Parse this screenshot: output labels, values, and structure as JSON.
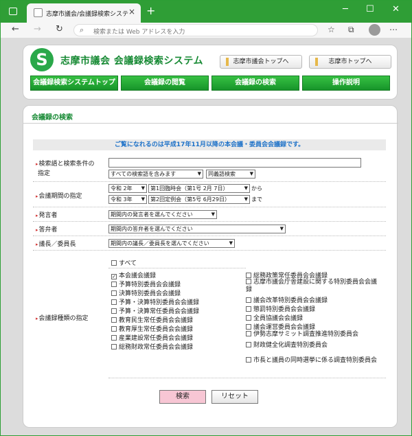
{
  "browser": {
    "tab_title": "志摩市議会/会議録検索システム",
    "close_tab": "×",
    "new_tab": "+",
    "address_placeholder": "検索または Web アドレスを入力",
    "back": "←",
    "forward": "→",
    "reload": "↻",
    "minimize": "─",
    "maximize": "☐",
    "close": "✕",
    "more": "⋯"
  },
  "header": {
    "site_title": "志摩市議会  会議録検索システム",
    "link_council_top": "志摩市議会トップへ",
    "link_city_top": "志摩市トップへ",
    "nav": [
      "会議録検索システムトップ",
      "会議録の閲覧",
      "会議録の検索",
      "操作説明"
    ]
  },
  "search": {
    "section_title": "会議録の検索",
    "notice": "ご覧になれるのは平成17年11月以降の本会議・委員会会議録です。",
    "keyword_label_1": "検索語と検索条件の",
    "keyword_label_2": "指定",
    "keyword_value": "",
    "keyword_condition": "すべての検索語を含みます",
    "keyword_type": "同義語検索",
    "period_label": "会議期間の指定",
    "period_from_era": "令和 2年",
    "period_from_session": "第1回臨時会（第1号 2月 7日）",
    "period_from_suffix": "から",
    "period_to_era": "令和 3年",
    "period_to_session": "第2回定例会（第5号 6月29日）",
    "period_to_suffix": "まで",
    "speaker_label": "発言者",
    "speaker_value": "期間内の発言者を選んでください",
    "answerer_label": "答弁者",
    "answerer_value": "期間内の答弁者を選んでください",
    "chair_label": "議長／委員長",
    "chair_value": "期間内の議長／委員長を選んでください",
    "type_label": "会議録種類の指定",
    "all_label": "すべて",
    "types_left": [
      {
        "label": "本会議会議録",
        "checked": true
      },
      {
        "label": "予算特別委員会会議録",
        "checked": false
      },
      {
        "label": "決算特別委員会会議録",
        "checked": false
      },
      {
        "label": "予算・決算特別委員会会議録",
        "checked": false
      },
      {
        "label": "予算・決算常任委員会会議録",
        "checked": false
      },
      {
        "label": "教育民生常任委員会会議録",
        "checked": false
      },
      {
        "label": "教育厚生常任委員会会議録",
        "checked": false
      },
      {
        "label": "産業建設常任委員会会議録",
        "checked": false
      },
      {
        "label": "総務財政常任委員会会議録",
        "checked": false
      }
    ],
    "types_right": [
      {
        "label": "総務政策常任委員会会議録",
        "checked": false
      },
      {
        "label": "志摩市議会庁舎建設に関する特別委員会会議録",
        "checked": false
      },
      {
        "label": "議会改革特別委員会会議録",
        "checked": false
      },
      {
        "label": "懲罰特別委員会会議録",
        "checked": false
      },
      {
        "label": "全員協議会会議録",
        "checked": false
      },
      {
        "label": "議会運営委員会会議録",
        "checked": false
      },
      {
        "label": "伊勢志摩サミット調査推進特別委員会",
        "checked": false
      },
      {
        "label": "財政健全化調査特別委員会",
        "checked": false
      },
      {
        "label": "市長と議員の同時選挙に係る調査特別委員会",
        "checked": false
      }
    ],
    "search_button": "検索",
    "reset_button": "リセット"
  },
  "colors": {
    "brand_green": "#2f9e36",
    "link_blue": "#1e72c8",
    "search_button_bg": "#f7c6d4"
  }
}
